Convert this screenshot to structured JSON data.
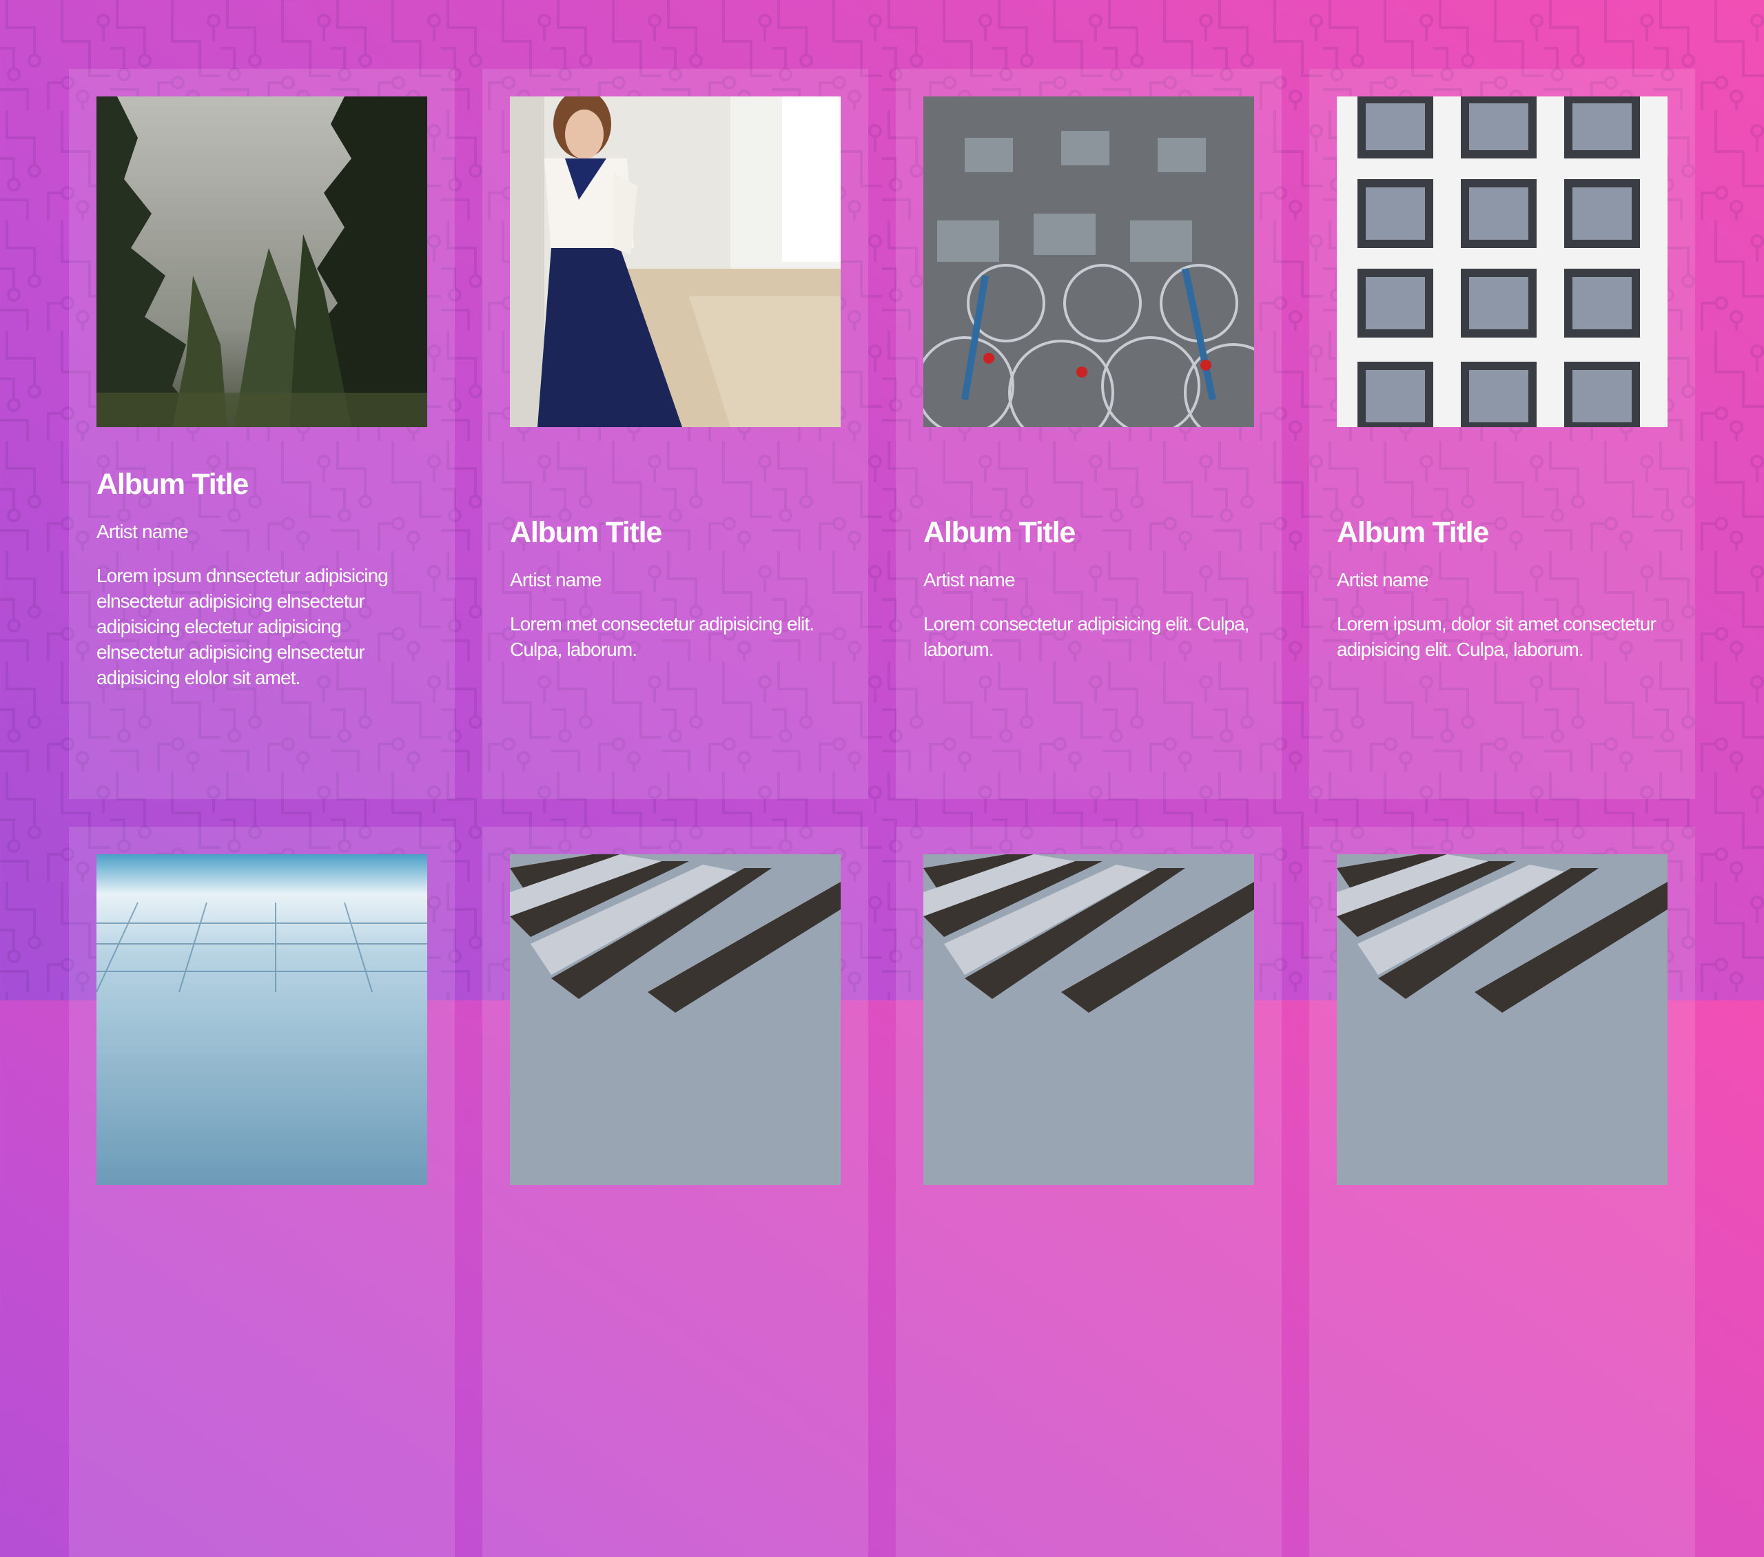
{
  "albums": [
    {
      "title": "Album Title",
      "artist": "Artist name",
      "description": "Lorem ipsum dnnsectetur adipisicing elnsectetur adipisicing elnsectetur adipisicing electetur adipisicing elnsectetur adipisicing elnsectetur adipisicing elolor sit amet.",
      "image": "forest-trees-photo"
    },
    {
      "title": "Album Title",
      "artist": "Artist name",
      "description": "Lorem met consectetur adipisicing elit. Culpa, laborum.",
      "image": "woman-sailor-blouse-photo"
    },
    {
      "title": "Album Title",
      "artist": "Artist name",
      "description": "Lorem consectetur adipisicing elit. Culpa, laborum.",
      "image": "parked-bicycles-photo"
    },
    {
      "title": "Album Title",
      "artist": "Artist name",
      "description": "Lorem ipsum, dolor sit amet consectetur adipisicing elit. Culpa, laborum.",
      "image": "building-windows-photo"
    },
    {
      "image": "glass-grid-horizon-photo"
    },
    {
      "image": "curved-building-facade-photo"
    },
    {
      "image": "curved-building-facade-photo"
    },
    {
      "image": "curved-building-facade-photo"
    }
  ],
  "colors": {
    "background_start": "#f24fb4",
    "background_end": "#a54fd6",
    "card_overlay": "rgba(255,255,255,0.13)",
    "text": "#ffffff"
  }
}
